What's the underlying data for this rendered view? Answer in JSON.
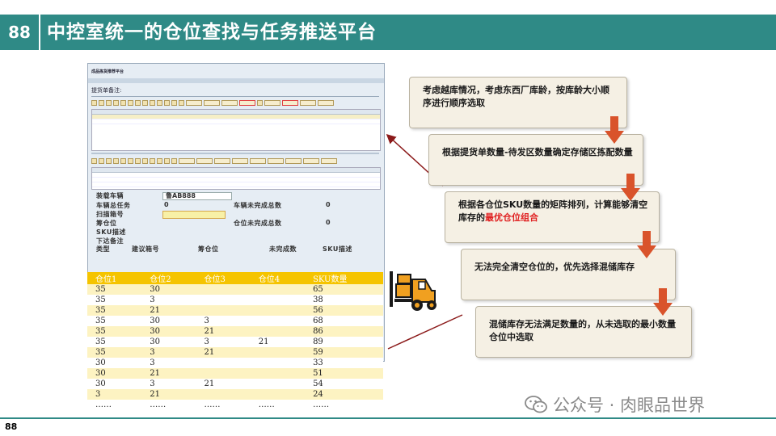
{
  "slide": {
    "number": "88",
    "title": "中控室统一的仓位查找与任务推送平台",
    "footer_number": "88",
    "watermark": "公众号 · 肉眼品世界"
  },
  "sap": {
    "title": "成品拣货推荐平台",
    "label": "提货单备注:"
  },
  "form": {
    "vehicle_label": "装载车辆",
    "vehicle_value": "鲁AB888",
    "total_tasks_label": "车辆总任务",
    "total_tasks_value": "0",
    "unfinished_label": "车辆未完成总数",
    "unfinished_value": "0",
    "scan_label": "扫描箱号",
    "pos_label": "筹仓位",
    "pos_unfinished_label": "仓位未完成总数",
    "pos_unfinished_value": "0",
    "sku_desc_label": "SKU描述",
    "remark_label": "下达备注",
    "col_type": "类型",
    "col_suggest": "建议箱号",
    "col_pos": "筹仓位",
    "col_unfinished": "未完成数",
    "col_sku": "SKU描述"
  },
  "table": {
    "headers": [
      "仓位1",
      "仓位2",
      "仓位3",
      "仓位4",
      "SKU数量"
    ],
    "rows": [
      [
        "35",
        "30",
        "",
        "",
        "65"
      ],
      [
        "35",
        "3",
        "",
        "",
        "38"
      ],
      [
        "35",
        "21",
        "",
        "",
        "56"
      ],
      [
        "35",
        "30",
        "3",
        "",
        "68"
      ],
      [
        "35",
        "30",
        "21",
        "",
        "86"
      ],
      [
        "35",
        "30",
        "3",
        "21",
        "89"
      ],
      [
        "35",
        "3",
        "21",
        "",
        "59"
      ],
      [
        "30",
        "3",
        "",
        "",
        "33"
      ],
      [
        "30",
        "21",
        "",
        "",
        "51"
      ],
      [
        "30",
        "3",
        "21",
        "",
        "54"
      ],
      [
        "3",
        "21",
        "",
        "",
        "24"
      ],
      [
        "……",
        "……",
        "……",
        "……",
        "……"
      ]
    ]
  },
  "steps": [
    {
      "text": "考虑越库情况，考虑东西厂库龄，按库龄大小顺序进行顺序选取"
    },
    {
      "text": "根据提货单数量-待发区数量确定存储区拣配数量"
    },
    {
      "text": "根据各仓位SKU数量的矩阵排列，计算能够清空库存的",
      "highlight": "最优仓位组合"
    },
    {
      "text": "无法完全清空仓位的，优先选择混储库存"
    },
    {
      "text": "混储库存无法满足数量的，从未选取的最小数量仓位中选取"
    }
  ],
  "colors": {
    "header_teal": "#2f8a86",
    "table_header": "#f5c400",
    "table_odd": "#fdf3c2",
    "step_bg": "#f5f0e4",
    "arrow": "#d9532b",
    "pointer_line": "#8b1a1a",
    "highlight_text": "#e02020"
  }
}
